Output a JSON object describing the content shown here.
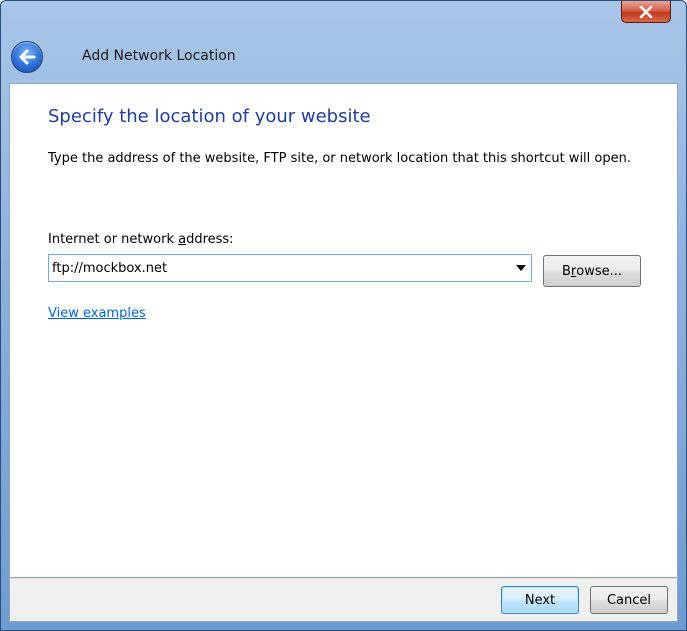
{
  "window": {
    "title": "Add Network Location",
    "close_icon": "close-icon",
    "back_icon": "back-arrow-icon"
  },
  "main": {
    "heading": "Specify the location of your website",
    "description": "Type the address of the website, FTP site, or network location that this shortcut will open.",
    "address_label_prefix": "Internet or network ",
    "address_label_accel": "a",
    "address_label_suffix": "ddress:",
    "address_value": "ftp://mockbox.net",
    "browse_prefix": "B",
    "browse_accel": "r",
    "browse_suffix": "owse...",
    "view_examples": "View examples"
  },
  "footer": {
    "next_label": "Next",
    "cancel_label": "Cancel"
  },
  "colors": {
    "heading": "#1f3d99",
    "link": "#0066cc",
    "titlebar": "#8fb3df",
    "close_button": "#c2391f"
  }
}
